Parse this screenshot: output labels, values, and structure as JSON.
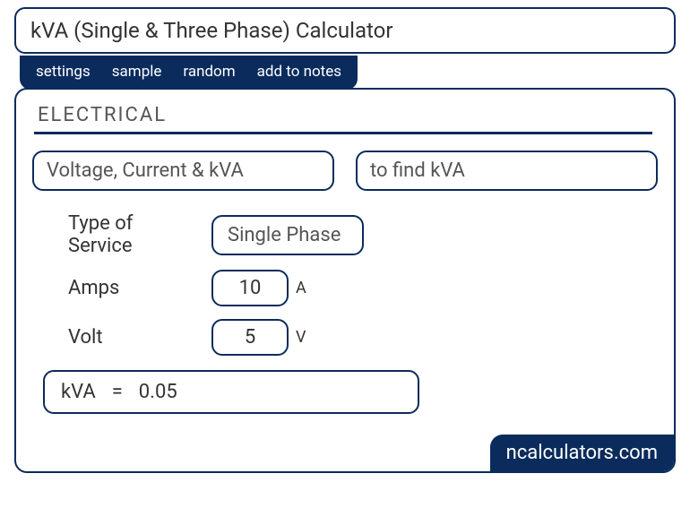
{
  "title": "kVA (Single & Three Phase) Calculator",
  "tabs": {
    "settings": "settings",
    "sample": "sample",
    "random": "random",
    "add_to_notes": "add to notes"
  },
  "section": "ELECTRICAL",
  "selectors": {
    "mode": "Voltage, Current & kVA",
    "goal": "to find kVA"
  },
  "fields": {
    "type_of_service_label": "Type of\nService",
    "type_of_service_value": "Single Phase",
    "amps_label": "Amps",
    "amps_value": "10",
    "amps_unit": "A",
    "volt_label": "Volt",
    "volt_value": "5",
    "volt_unit": "V"
  },
  "result": {
    "label": "kVA",
    "eq": "=",
    "value": "0.05"
  },
  "watermark": "ncalculators.com"
}
